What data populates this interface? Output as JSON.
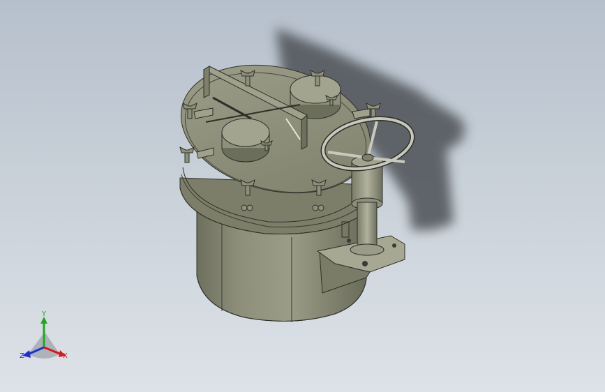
{
  "viewport": {
    "background_top": "#b6c0cc",
    "background_bottom": "#dde2e8",
    "model_color": "#8a8c78",
    "shadow_color": "#4a4d52"
  },
  "triad": {
    "x_label": "X",
    "y_label": "Y",
    "z_label": "Z",
    "x_color": "#d81818",
    "y_color": "#1ea81e",
    "z_color": "#2030d0"
  },
  "model": {
    "icon": "pressure-tank-model"
  }
}
